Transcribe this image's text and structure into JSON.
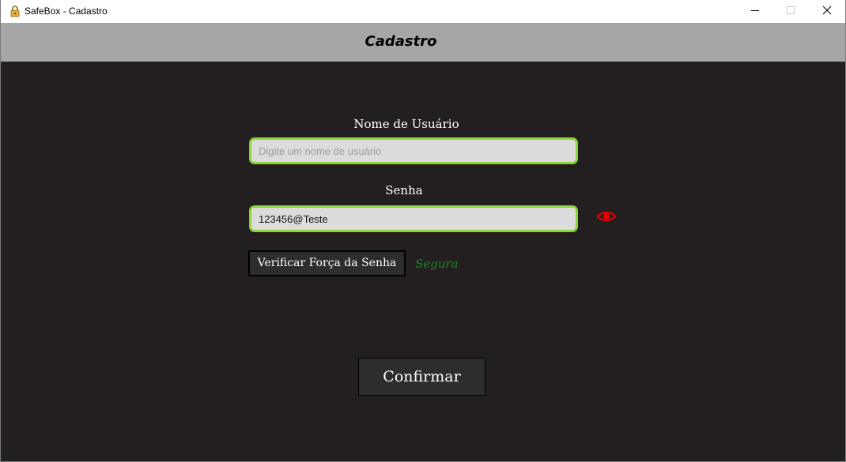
{
  "window": {
    "title": "SafeBox - Cadastro",
    "app_icon": "lock-icon",
    "controls": {
      "minimize_icon": "minimize-icon",
      "maximize_icon": "maximize-icon",
      "close_icon": "close-icon"
    }
  },
  "header": {
    "title": "Cadastro"
  },
  "form": {
    "username": {
      "label": "Nome de Usuário",
      "value": "",
      "placeholder": "Digite um nome de usuário"
    },
    "password": {
      "label": "Senha",
      "value": "123456@Teste",
      "placeholder": "",
      "toggle_icon": "eye-icon"
    },
    "strength_button_label": "Verificar Força da Senha",
    "strength_result": "Segura",
    "confirm_label": "Confirmar"
  },
  "colors": {
    "background": "#231f20",
    "header": "#a6a6a6",
    "field_border": "#8bd43a",
    "field_bg": "#dcdcdc",
    "eye_icon": "#e00000",
    "strength_ok": "#1a8a1a",
    "button_bg": "#2d2d2d"
  }
}
